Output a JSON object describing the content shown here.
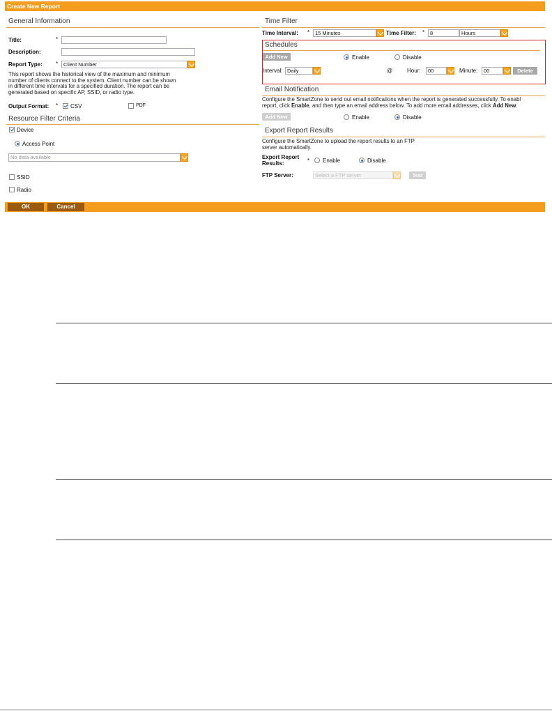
{
  "window": {
    "title": "Create New Report"
  },
  "general": {
    "heading": "General Information",
    "title_label": "Title:",
    "title_value": "",
    "description_label": "Description:",
    "description_value": "",
    "report_type_label": "Report Type:",
    "report_type_value": "Client Number",
    "required_mark": "*",
    "desc_text": [
      "This report shows the historical view of the maximum and minimum",
      "number of clients connect to the system. Client number can be shown",
      "in different time intervals for a specified duration. The report can be",
      "generated based on specific AP, SSID, or radio type."
    ],
    "output_format_label": "Output Format:",
    "csv_label": "CSV",
    "csv_checked": true,
    "pdf_label": "PDF",
    "pdf_checked": false
  },
  "resource": {
    "heading": "Resource Filter Criteria",
    "device_label": "Device",
    "device_checked": true,
    "access_point_label": "Access Point",
    "access_point_selected": true,
    "ap_select_value": "No data available",
    "ssid_label": "SSID",
    "ssid_checked": false,
    "radio_label": "Radio",
    "radio_checked": false
  },
  "time_filter": {
    "heading": "Time Filter",
    "interval_label": "Time Interval:",
    "interval_value": "15 Minutes",
    "filter_label": "Time Filter:",
    "filter_value": "8",
    "filter_unit": "Hours"
  },
  "schedules": {
    "heading": "Schedules",
    "add_new_label": "Add New",
    "enable_label": "Enable",
    "enable_selected": true,
    "disable_label": "Disable",
    "interval_label": "Interval:",
    "interval_value": "Daily",
    "at_symbol": "@",
    "hour_label": "Hour:",
    "hour_value": "00",
    "minute_label": "Minute:",
    "minute_value": "00",
    "delete_label": "Delete"
  },
  "email": {
    "heading": "Email Notification",
    "desc_line1": "Configure the SmartZone to send out email notifications when the report is generated successfully. To enabl",
    "desc_line2_a": "report, click ",
    "desc_line2_b": "Enable",
    "desc_line2_c": ", and then type an email address below. To add more email addresses, click ",
    "desc_line2_d": "Add New",
    "desc_line2_e": ".",
    "add_new_label": "Add New",
    "enable_label": "Enable",
    "disable_label": "Disable",
    "disable_selected": true
  },
  "export": {
    "heading": "Export Report Results",
    "desc_line1": "Configure the SmartZone to upload the report results to an FTP",
    "desc_line2": "server automatically.",
    "results_label_1": "Export Report",
    "results_label_2": "Results:",
    "enable_label": "Enable",
    "disable_label": "Disable",
    "disable_selected": true,
    "ftp_label": "FTP Server:",
    "ftp_placeholder": "Select a FTP server",
    "test_label": "Test"
  },
  "footer": {
    "ok_label": "OK",
    "cancel_label": "Cancel"
  },
  "colors": {
    "accent": "#f39c1e",
    "button_dark": "#9a5a10",
    "highlight": "#d9232d"
  }
}
